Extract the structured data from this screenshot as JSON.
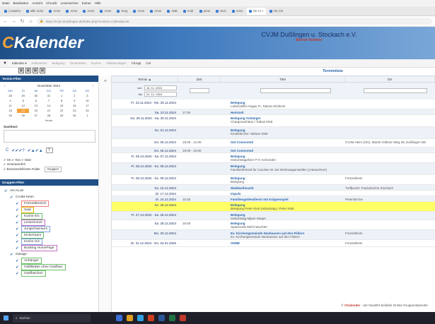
{
  "menu": [
    "Datei",
    "Bearbeiten",
    "Ansicht",
    "Chronik",
    "Lesezeichen",
    "Extras",
    "Hilfe"
  ],
  "tabs": [
    "( waseho",
    "Mile Schu",
    "Arme",
    "Arme",
    "Arme",
    "Arme",
    "Kreg",
    "Arme",
    "Arme",
    "ABB",
    "Andr",
    "arme",
    "Desi",
    "Arme",
    "OK CI ×",
    "OK Chr"
  ],
  "url": "https://cvjm-dusslingen.de/index.php?content=CalendarList",
  "header": {
    "logo_c": "C",
    "logo_rest": "Kalender",
    "org": "CVJM Dußlingen u. Stockach e.V.",
    "user": "Bernd Vollmer"
  },
  "toolbar": [
    "Kalender ▾",
    "Dokumente",
    "Belegung",
    "Terminlisten",
    "Suchen",
    "Plakatvorlagen",
    "CKApp",
    "Cal"
  ],
  "sidebar": {
    "termin_filter": "Termin-Filter",
    "cal_month": "November 2024",
    "cal_dow": [
      "MO",
      "DI",
      "MI",
      "DO",
      "FR",
      "SA",
      "SO"
    ],
    "cal_days": [
      "28",
      "29",
      "30",
      "31",
      "1",
      "2",
      "3",
      "4",
      "5",
      "6",
      "7",
      "8",
      "9",
      "10",
      "11",
      "12",
      "13",
      "14",
      "15",
      "16",
      "17",
      "18",
      "19",
      "20",
      "21",
      "22",
      "23",
      "24",
      "25",
      "26",
      "27",
      "28",
      "29",
      "30",
      "1"
    ],
    "heute": "Heute",
    "suchtext": "Suchtext:",
    "opt1": "✔ Ort  ✔ Text  ✔ Notiz",
    "opt2": "✔ Verantwortlich",
    "opt3": "✔ Benutzerdefinierte Felder",
    "gruppen_btn": "Gruppen",
    "gruppen_filter": "Gruppen-Filter",
    "groups": [
      "AN ALLE",
      "CVJM-Heim",
      "Freizeitbereich",
      "Saal",
      "Küche EG",
      "Lesezimmer",
      "Jungscharraum",
      "Kickerraum",
      "Küche UG",
      "Booking HomePage",
      "Garage",
      "Anhänger",
      "Grill/Bräter ohne Gasflasc",
      "Gasflaschen"
    ]
  },
  "main": {
    "title": "Terminliste",
    "cols": [
      "Termin ▲",
      "Zeit",
      "Titel",
      "Ort"
    ],
    "von_lbl": "von",
    "von_val": "16. 11. 2024",
    "bis_lbl": "bis",
    "bis_val": "01. 12. 2024"
  },
  "rows": [
    {
      "d": "Fr. 22.11.2024 - Mo. 25.11.2024",
      "z": "",
      "t": "Belegung",
      "s": "Lebenshilfe Hegau Fr. Tatena Hitzbeck",
      "o": ""
    },
    {
      "d": "Sa. 23.11.2024",
      "z": "17:00",
      "t": "Heimzeit",
      "s": "",
      "o": ""
    },
    {
      "d": "Do. 28.11.2024 - Sa. 30.11.2024",
      "z": "",
      "t": "Belegung Anhänger",
      "s": "Chargenanhäne / Tobias Klett",
      "o": ""
    },
    {
      "d": "So. 01.12.2024",
      "z": "",
      "t": "Belegung",
      "s": "Kinderkirche / Miriam Klett",
      "o": ""
    },
    {
      "d": "Do. 05.12.2024",
      "z": "18:00 - 21:00",
      "t": "Get Connected",
      "s": "",
      "o": "CVJM Heim (OG), Martin-Vollmer-Weg 28, Dußlingen DE"
    },
    {
      "d": "Do. 05.12.2024",
      "z": "18:00 - 23:00",
      "t": "Get Connected",
      "s": "",
      "o": ""
    },
    {
      "d": "Fr. 06.12.2024 - Sa. 07.12.2024",
      "z": "",
      "t": "Belegung",
      "s": "Geburtstagsfeier P-G Schneider",
      "o": ""
    },
    {
      "d": "Fr. 06.12.2024 - So. 08.12.2024",
      "z": "",
      "t": "Belegung",
      "s": "Familienfreizeit für Caroline W. bei Wohnwagenstellen (4 Bewohner)",
      "o": ""
    },
    {
      "d": "Fr. 06.12.2024 - So. 08.12.2024",
      "z": "",
      "t": "Belegung",
      "s": "Belegung",
      "o": "Freizeitheim"
    },
    {
      "d": "So. 15.12.2024",
      "z": "",
      "t": "Waldweihnacht",
      "s": "",
      "o": "Treffpunkt: Paulusküche Stockach"
    },
    {
      "d": "Di. 17.12.2024",
      "z": "",
      "t": "Impuls",
      "s": "",
      "o": ""
    },
    {
      "d": "Di. 24.12.2024",
      "z": "15:30",
      "t": "Familiengottesdienst mit Krippenspiel",
      "s": "",
      "o": "Peterskirche"
    },
    {
      "d": "So. 26.12.2024",
      "z": "",
      "t": "Belegung",
      "s": "Belegung Peter Klett Geburtstag / Peter Klett",
      "o": ""
    },
    {
      "d": "Fr. 27.12.2024 - Sa. 28.12.2024",
      "z": "",
      "t": "Belegung",
      "s": "Geburtstag Mijam Steger",
      "o": ""
    },
    {
      "d": "Sa. 28.12.2024",
      "z": "16:00",
      "t": "Belegung",
      "s": "Spaerunde Micht Wuchter",
      "o": ""
    },
    {
      "d": "Mo. 30.12.2024",
      "z": "",
      "t": "Ev. Kirchengemeinde Neuhausen auf den Fildern",
      "s": "Ev. Kirchengemeinde Neuhausen auf den Fildern",
      "o": "Freizeitheim"
    },
    {
      "d": "Di. 31.12.2024 - Do. 02.01.2025",
      "z": "",
      "t": "OHNE",
      "s": "",
      "o": "Freizeitheim"
    }
  ],
  "footer": {
    "copy": "© ",
    "brand": "CKalender",
    "rest": " - der bewährt-beliebte Online-Gruppenkalender"
  },
  "taskbar": {
    "search": "Suchen"
  }
}
